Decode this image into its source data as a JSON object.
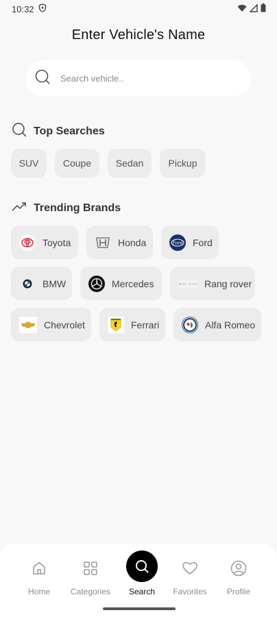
{
  "status_bar": {
    "time": "10:32"
  },
  "title": "Enter Vehicle's Name",
  "search": {
    "placeholder": "Search vehicle..",
    "value": ""
  },
  "top_searches": {
    "heading": "Top Searches",
    "items": [
      "SUV",
      "Coupe",
      "Sedan",
      "Pickup"
    ]
  },
  "trending_brands": {
    "heading": "Trending Brands",
    "items": [
      {
        "label": "Toyota",
        "icon": "toyota-logo-icon"
      },
      {
        "label": "Honda",
        "icon": "honda-logo-icon"
      },
      {
        "label": "Ford",
        "icon": "ford-logo-icon"
      },
      {
        "label": "BMW",
        "icon": "bmw-logo-icon"
      },
      {
        "label": "Mercedes",
        "icon": "mercedes-logo-icon"
      },
      {
        "label": "Rang rover",
        "icon": "range-rover-logo-icon"
      },
      {
        "label": "Chevrolet",
        "icon": "chevrolet-logo-icon"
      },
      {
        "label": "Ferrari",
        "icon": "ferrari-logo-icon"
      },
      {
        "label": "Alfa Romeo",
        "icon": "alfa-romeo-logo-icon"
      }
    ]
  },
  "bottom_nav": {
    "active": "Search",
    "items": [
      {
        "label": "Home",
        "icon": "home-icon"
      },
      {
        "label": "Categories",
        "icon": "grid-icon"
      },
      {
        "label": "Search",
        "icon": "search-icon"
      },
      {
        "label": "Favorites",
        "icon": "heart-icon"
      },
      {
        "label": "Profile",
        "icon": "profile-icon"
      }
    ]
  },
  "colors": {
    "background": "#f8f8f8",
    "chip": "#ececec",
    "active_nav": "#000000",
    "ford_blue": "#1b2f6b"
  }
}
